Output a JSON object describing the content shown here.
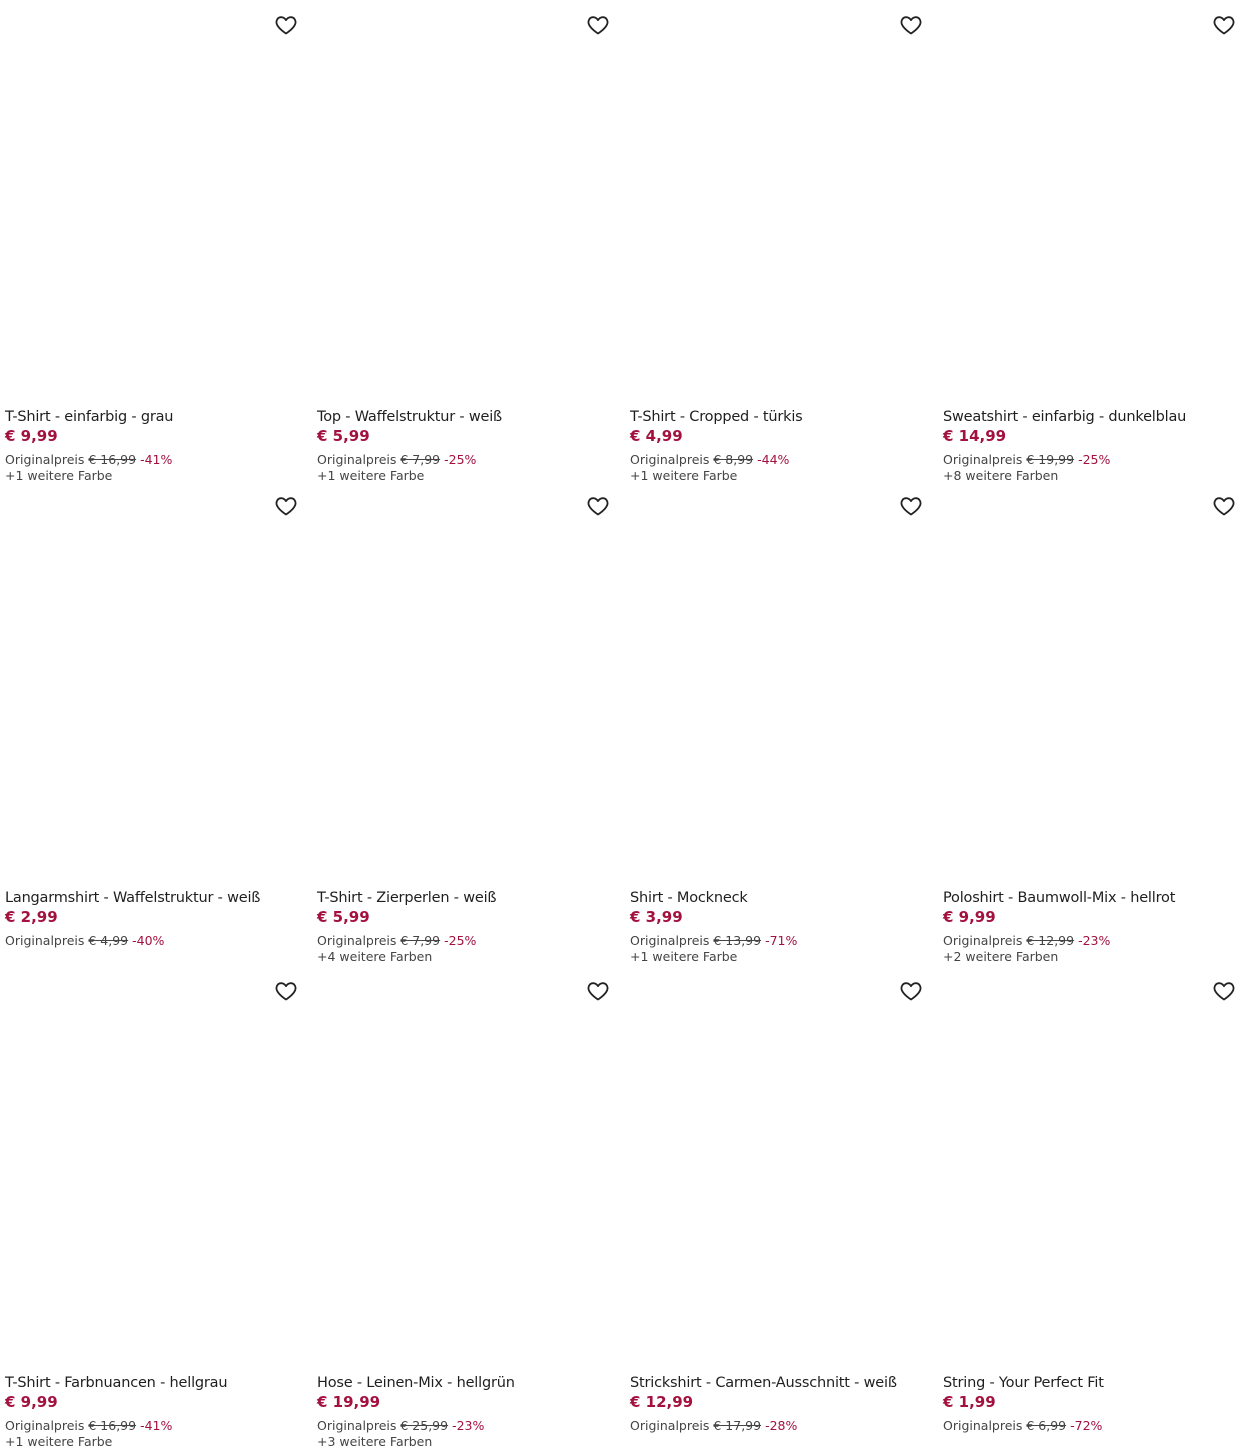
{
  "products": [
    {
      "title": "T-Shirt - einfarbig - grau",
      "price": "€ 9,99",
      "orig_label": "Originalpreis",
      "orig_price": "€ 16,99",
      "discount": "-41%",
      "colors": "+1 weitere Farbe"
    },
    {
      "title": "Top - Waffelstruktur - weiß",
      "price": "€ 5,99",
      "orig_label": "Originalpreis",
      "orig_price": "€ 7,99",
      "discount": "-25%",
      "colors": "+1 weitere Farbe"
    },
    {
      "title": "T-Shirt - Cropped - türkis",
      "price": "€ 4,99",
      "orig_label": "Originalpreis",
      "orig_price": "€ 8,99",
      "discount": "-44%",
      "colors": "+1 weitere Farbe"
    },
    {
      "title": "Sweatshirt - einfarbig - dunkelblau",
      "price": "€ 14,99",
      "orig_label": "Originalpreis",
      "orig_price": "€ 19,99",
      "discount": "-25%",
      "colors": "+8 weitere Farben"
    },
    {
      "title": "Langarmshirt - Waffelstruktur - weiß",
      "price": "€ 2,99",
      "orig_label": "Originalpreis",
      "orig_price": "€ 4,99",
      "discount": "-40%",
      "colors": ""
    },
    {
      "title": "T-Shirt - Zierperlen - weiß",
      "price": "€ 5,99",
      "orig_label": "Originalpreis",
      "orig_price": "€ 7,99",
      "discount": "-25%",
      "colors": "+4 weitere Farben"
    },
    {
      "title": "Shirt - Mockneck",
      "price": "€ 3,99",
      "orig_label": "Originalpreis",
      "orig_price": "€ 13,99",
      "discount": "-71%",
      "colors": "+1 weitere Farbe"
    },
    {
      "title": "Poloshirt - Baumwoll-Mix - hellrot",
      "price": "€ 9,99",
      "orig_label": "Originalpreis",
      "orig_price": "€ 12,99",
      "discount": "-23%",
      "colors": "+2 weitere Farben"
    },
    {
      "title": "T-Shirt - Farbnuancen - hellgrau",
      "price": "€ 9,99",
      "orig_label": "Originalpreis",
      "orig_price": "€ 16,99",
      "discount": "-41%",
      "colors": "+1 weitere Farbe"
    },
    {
      "title": "Hose - Leinen-Mix - hellgrün",
      "price": "€ 19,99",
      "orig_label": "Originalpreis",
      "orig_price": "€ 25,99",
      "discount": "-23%",
      "colors": "+3 weitere Farben"
    },
    {
      "title": "Strickshirt - Carmen-Ausschnitt - weiß",
      "price": "€ 12,99",
      "orig_label": "Originalpreis",
      "orig_price": "€ 17,99",
      "discount": "-28%",
      "colors": ""
    },
    {
      "title": "String - Your Perfect Fit",
      "price": "€ 1,99",
      "orig_label": "Originalpreis",
      "orig_price": "€ 6,99",
      "discount": "-72%",
      "colors": ""
    }
  ],
  "colors": {
    "price": "#a3113f",
    "text": "#1f1f1f",
    "muted": "#444444"
  },
  "icons": {
    "wishlist": "heart-outline-icon"
  }
}
